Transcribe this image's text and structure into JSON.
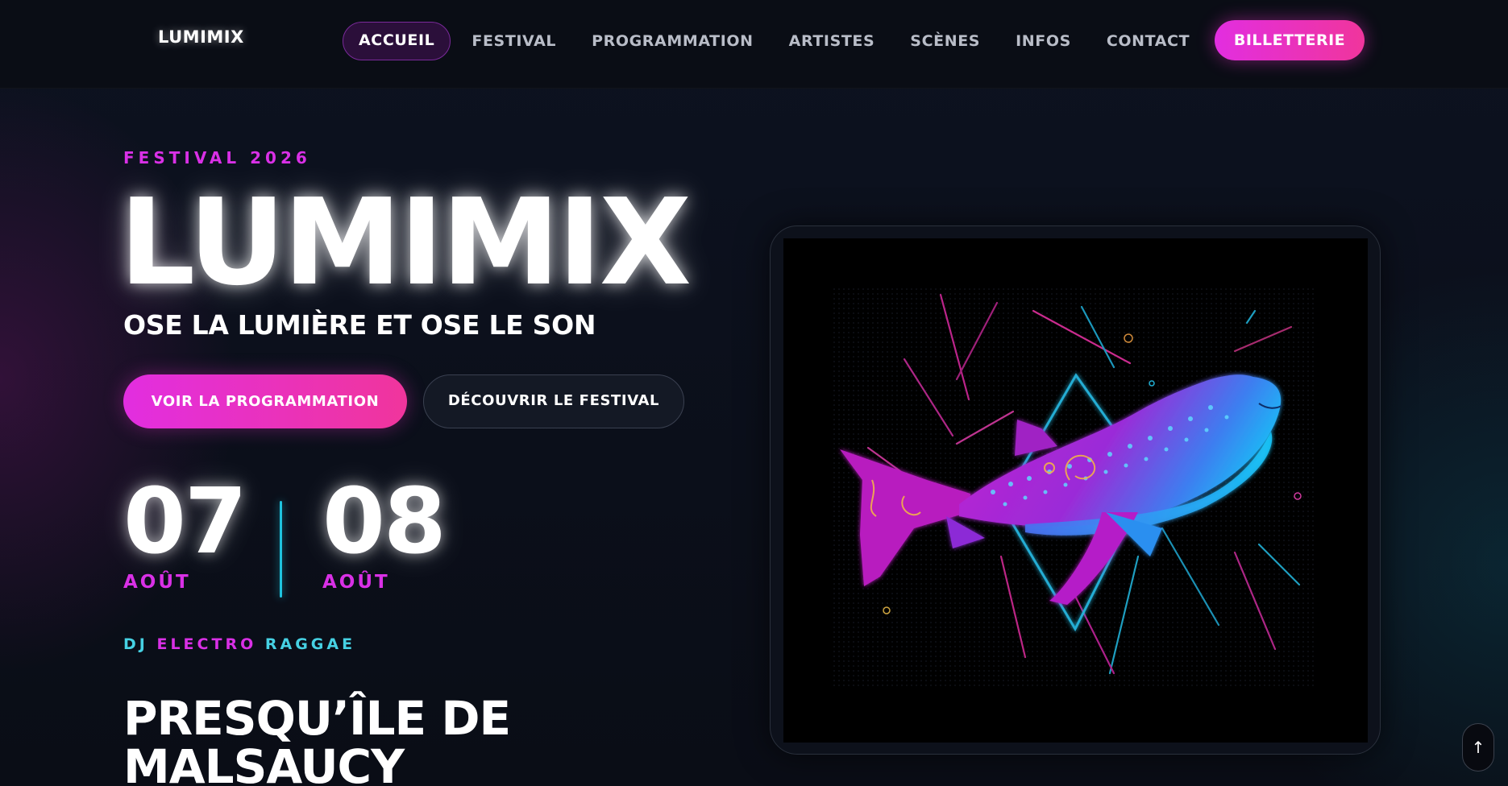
{
  "nav": {
    "logo": "LUMIMIX",
    "links": [
      "ACCUEIL",
      "FESTIVAL",
      "PROGRAMMATION",
      "ARTISTES",
      "SCÈNES",
      "INFOS",
      "CONTACT"
    ],
    "active_link": "ACCUEIL",
    "ticket_label": "BILLETTERIE"
  },
  "hero": {
    "eyebrow": "FESTIVAL 2026",
    "title": "LUMIMIX",
    "tagline": "OSE LA LUMIÈRE ET OSE LE SON",
    "primary_cta": "VOIR LA PROGRAMMATION",
    "secondary_cta": "DÉCOUVRIR LE FESTIVAL",
    "dates": [
      {
        "day": "07",
        "month": "AOÛT"
      },
      {
        "day": "08",
        "month": "AOÛT"
      }
    ],
    "genres": [
      "DJ",
      "ELECTRO",
      "RAGGAE"
    ],
    "location": "PRESQU’ÎLE DE MALSAUCY"
  },
  "artwork": {
    "subject": "whale-shark-illustration"
  },
  "scroll_top": {
    "icon": "↑"
  },
  "colors": {
    "accent_pink": "#d930e6",
    "accent_gradient_start": "#e22ee0",
    "accent_gradient_end": "#f0359c",
    "accent_cyan": "#1fc4df",
    "background": "#0b0e17"
  }
}
